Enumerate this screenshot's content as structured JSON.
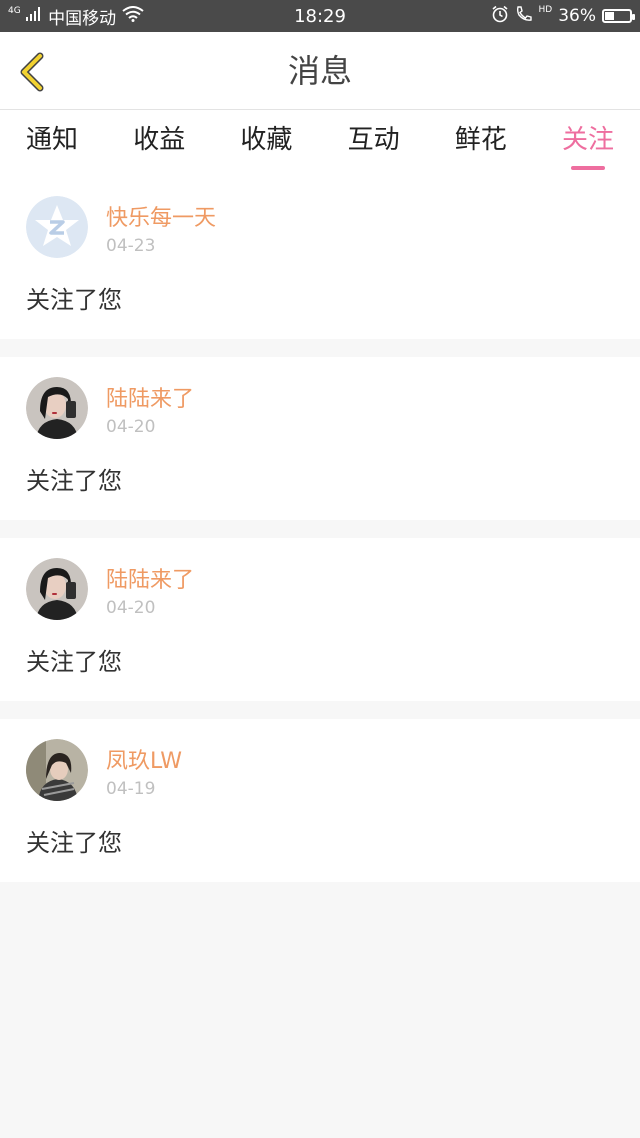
{
  "status": {
    "network": "4G",
    "carrier": "中国移动",
    "time": "18:29",
    "hd": "HD",
    "battery": "36%",
    "battery_level": 0.36
  },
  "nav": {
    "title": "消息",
    "back_icon": "chevron-left-icon",
    "accent": "#f2d230"
  },
  "tabs": [
    "通知",
    "收益",
    "收藏",
    "互动",
    "鲜花",
    "关注"
  ],
  "active_tab": 5,
  "colors": {
    "accent_pink": "#ee6e9f",
    "name_orange": "#ef9a63"
  },
  "items": [
    {
      "name": "快乐每一天",
      "date": "04-23",
      "message": "关注了您",
      "avatar": "default-star-avatar"
    },
    {
      "name": "陆陆来了",
      "date": "04-20",
      "message": "关注了您",
      "avatar": "photo-avatar"
    },
    {
      "name": "陆陆来了",
      "date": "04-20",
      "message": "关注了您",
      "avatar": "photo-avatar"
    },
    {
      "name": "凤玖LW",
      "date": "04-19",
      "message": "关注了您",
      "avatar": "photo-avatar"
    }
  ]
}
